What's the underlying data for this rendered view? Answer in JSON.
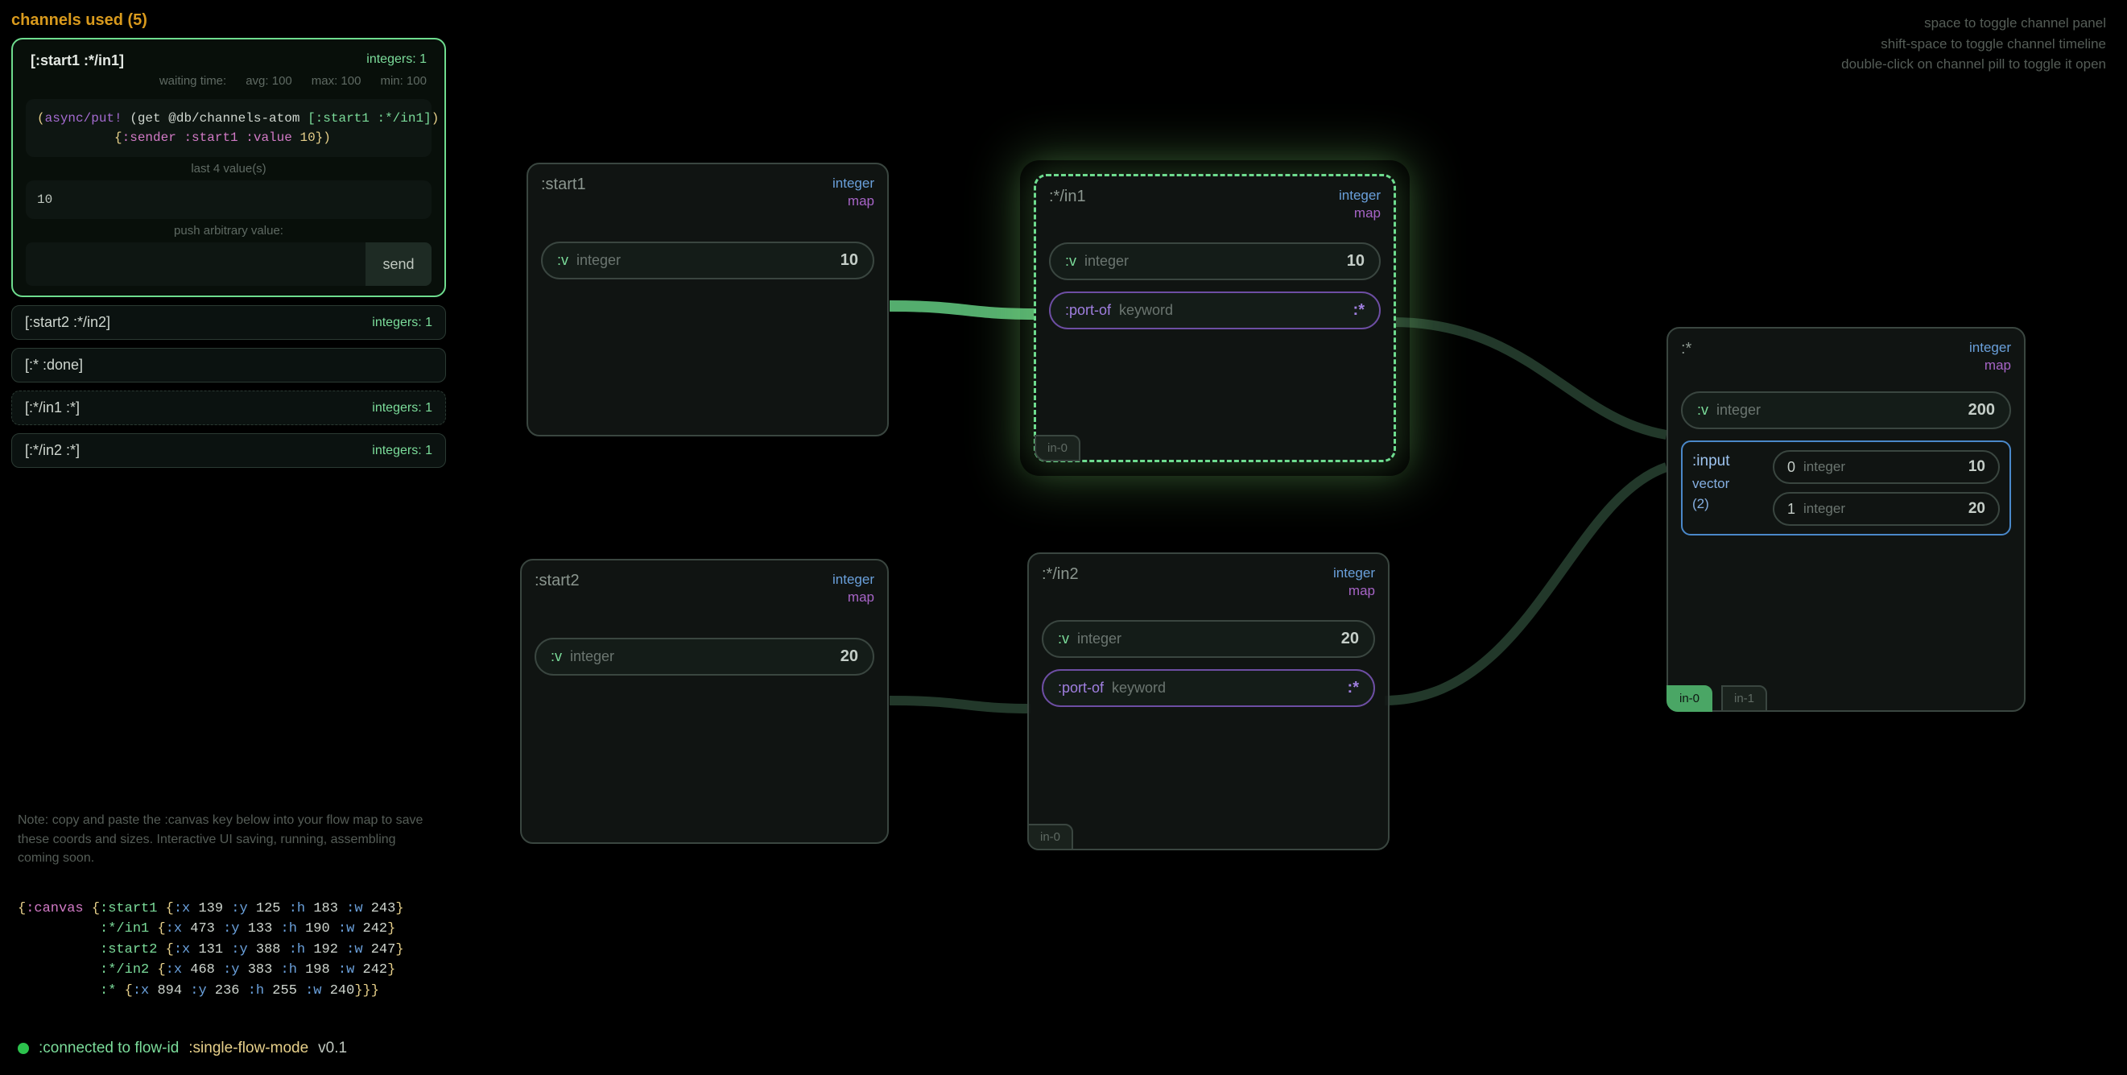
{
  "panel": {
    "title": "channels used (5)",
    "open": {
      "name": "[:start1 :*/in1]",
      "meta": "integers: 1",
      "stats": {
        "wait": "waiting time:",
        "avg": "avg: 100",
        "max": "max: 100",
        "min": "min: 100"
      },
      "code_line1_a": "(",
      "code_line1_b": "async/put!",
      "code_line1_c": " (get @db/channels-atom ",
      "code_line1_d": "[:start1 :*/in1]",
      "code_line1_e": ")",
      "code_line2_a": "          {",
      "code_line2_b": ":sender :start1 :value ",
      "code_line2_c": "10",
      "code_line2_d": "})",
      "last_label": "last 4 value(s)",
      "last_value": "10",
      "push_label": "push arbitrary value:",
      "send": "send"
    },
    "rows": [
      {
        "name": "[:start2 :*/in2]",
        "meta": "integers: 1",
        "dashed": false
      },
      {
        "name": "[:* :done]",
        "meta": "",
        "dashed": false
      },
      {
        "name": "[:*/in1 :*]",
        "meta": "integers: 1",
        "dashed": true
      },
      {
        "name": "[:*/in2 :*]",
        "meta": "integers: 1",
        "dashed": false
      }
    ]
  },
  "note": "Note: copy and paste the :canvas key below into your flow map to save these coords and sizes. Interactive UI saving, running, assembling coming soon.",
  "canvas_code": {
    "l1": "{:canvas {:start1 {:x 139 :y 125 :h 183 :w 243}",
    "l2": "          :*/in1 {:x 473 :y 133 :h 190 :w 242}",
    "l3": "          :start2 {:x 131 :y 388 :h 192 :w 247}",
    "l4": "          :*/in2 {:x 468 :y 383 :h 198 :w 242}",
    "l5": "          :* {:x 894 :y 236 :h 255 :w 240}}}"
  },
  "status": {
    "label": ":connected to flow-id",
    "mode": ":single-flow-mode",
    "ver": "v0.1"
  },
  "hints": {
    "l1": "space to toggle channel panel",
    "l2": "shift-space to toggle channel timeline",
    "l3": "double-click on channel pill to toggle it open"
  },
  "nodes": {
    "start1": {
      "title": ":start1",
      "type": "integer",
      "sub": "map",
      "pill_k": ":v",
      "pill_t": "integer",
      "pill_v": "10"
    },
    "in1": {
      "title": ":*/in1",
      "type": "integer",
      "sub": "map",
      "p1_k": ":v",
      "p1_t": "integer",
      "p1_v": "10",
      "p2_k": ":port-of",
      "p2_t": "keyword",
      "p2_v": ":*",
      "port": "in-0"
    },
    "start2": {
      "title": ":start2",
      "type": "integer",
      "sub": "map",
      "pill_k": ":v",
      "pill_t": "integer",
      "pill_v": "20"
    },
    "in2": {
      "title": ":*/in2",
      "type": "integer",
      "sub": "map",
      "p1_k": ":v",
      "p1_t": "integer",
      "p1_v": "20",
      "p2_k": ":port-of",
      "p2_t": "keyword",
      "p2_v": ":*",
      "port": "in-0"
    },
    "star": {
      "title": ":*",
      "type": "integer",
      "sub": "map",
      "p1_k": ":v",
      "p1_t": "integer",
      "p1_v": "200",
      "vec_label": ":input",
      "vec_sub1": "vector",
      "vec_sub2": "(2)",
      "v0_i": "0",
      "v0_t": "integer",
      "v0_v": "10",
      "v1_i": "1",
      "v1_t": "integer",
      "v1_v": "20",
      "port0": "in-0",
      "port1": "in-1"
    }
  }
}
